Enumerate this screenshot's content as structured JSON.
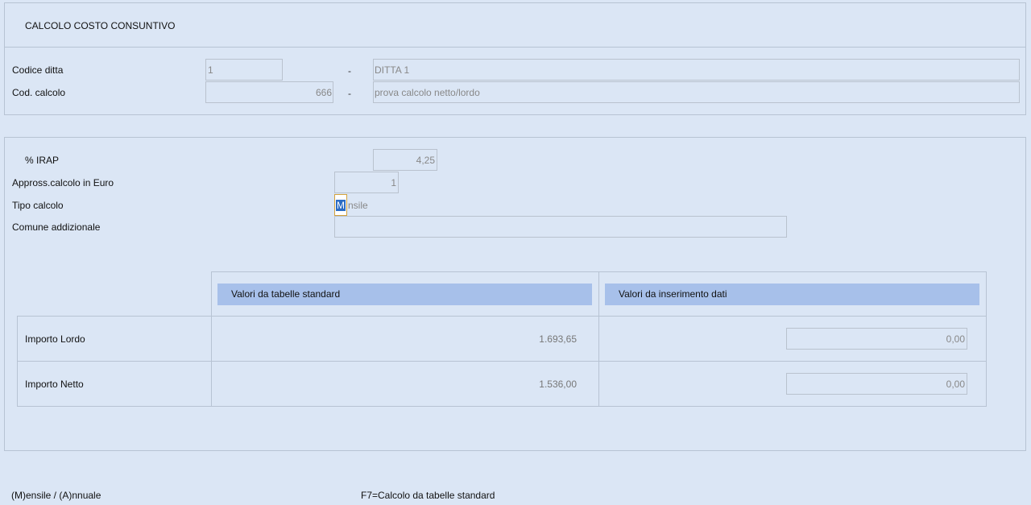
{
  "title": "CALCOLO COSTO CONSUNTIVO",
  "header_fields": {
    "codice_ditta_label": "Codice ditta",
    "codice_ditta_value": "1",
    "ditta_name": "DITTA 1",
    "cod_calcolo_label": "Cod. calcolo",
    "cod_calcolo_value": "666",
    "cod_calcolo_desc": "prova calcolo netto/lordo",
    "separator": "-"
  },
  "params": {
    "irap_label": "% IRAP",
    "irap_value": "4,25",
    "approx_label": "Appross.calcolo in Euro",
    "approx_value": "1",
    "tipo_label": "Tipo calcolo",
    "tipo_cursor_char": "M",
    "tipo_rest": "nsile",
    "comune_label": "Comune addizionale",
    "comune_value": ""
  },
  "table": {
    "col_headers": [
      "Valori da tabelle standard",
      "Valori da inserimento dati"
    ],
    "rows": [
      {
        "label": "Importo Lordo",
        "standard": "1.693,65",
        "input": "0,00"
      },
      {
        "label": "Importo Netto",
        "standard": "1.536,00",
        "input": "0,00"
      }
    ]
  },
  "footer": {
    "hint_left": "(M)ensile / (A)nnuale",
    "hint_right": "F7=Calcolo da tabelle standard"
  }
}
